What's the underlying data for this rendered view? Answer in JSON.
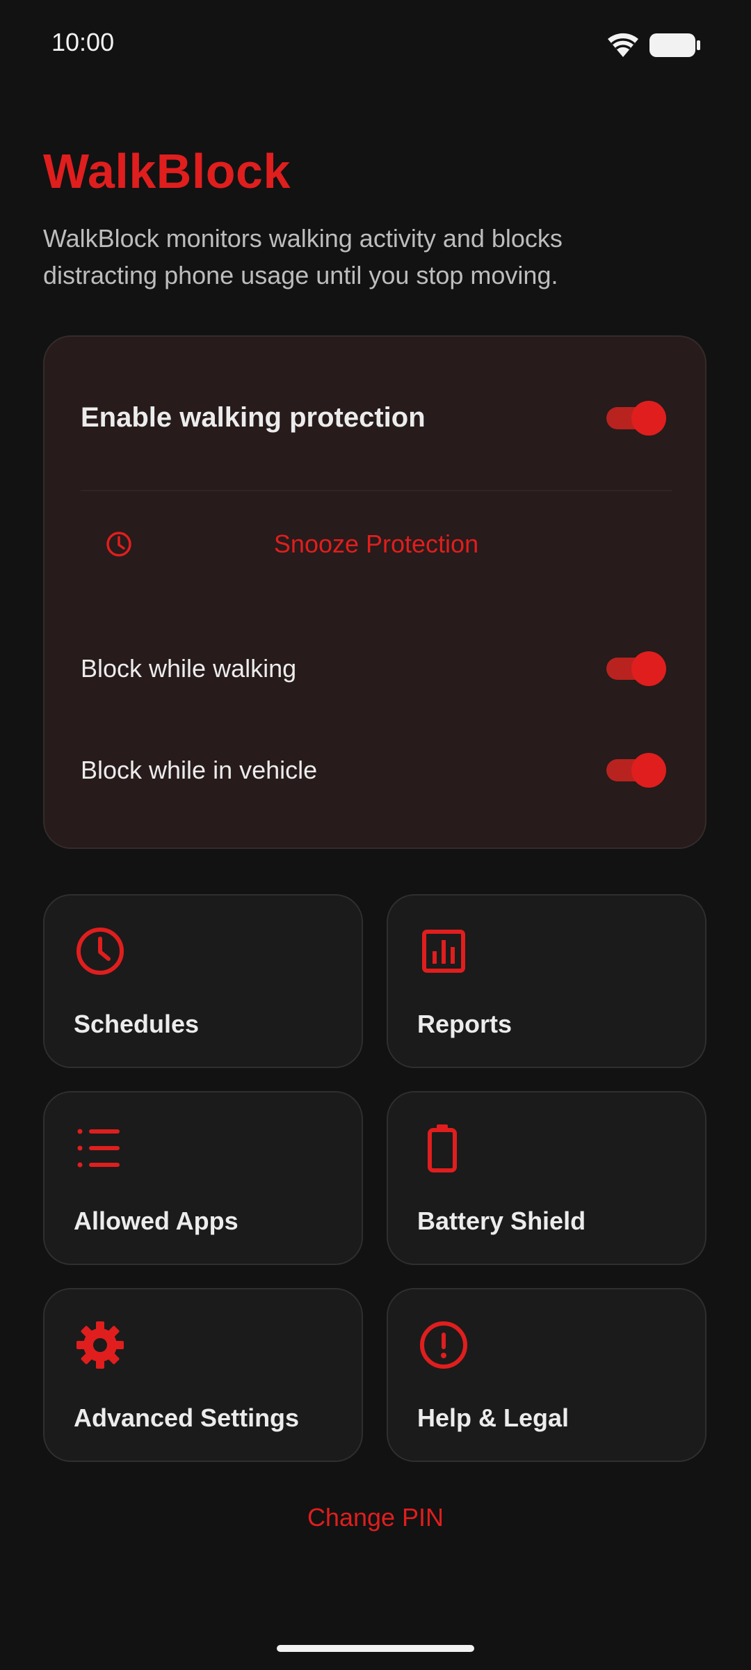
{
  "status_bar": {
    "time": "10:00"
  },
  "header": {
    "title": "WalkBlock",
    "description": "WalkBlock monitors walking activity and blocks distracting phone usage until you stop moving."
  },
  "protection": {
    "enable_label": "Enable walking protection",
    "enable_on": true,
    "snooze_label": "Snooze Protection",
    "block_walking_label": "Block while walking",
    "block_walking_on": true,
    "block_vehicle_label": "Block while in vehicle",
    "block_vehicle_on": true
  },
  "tiles": [
    {
      "label": "Schedules",
      "icon": "clock-icon"
    },
    {
      "label": "Reports",
      "icon": "bar-chart-icon"
    },
    {
      "label": "Allowed Apps",
      "icon": "list-icon"
    },
    {
      "label": "Battery Shield",
      "icon": "battery-icon"
    },
    {
      "label": "Advanced Settings",
      "icon": "gear-icon"
    },
    {
      "label": "Help & Legal",
      "icon": "alert-circle-icon"
    }
  ],
  "footer": {
    "change_pin_label": "Change PIN"
  },
  "colors": {
    "accent": "#e01e1e",
    "background": "#121212",
    "card": "#271b1b",
    "tile": "#1b1b1b"
  }
}
